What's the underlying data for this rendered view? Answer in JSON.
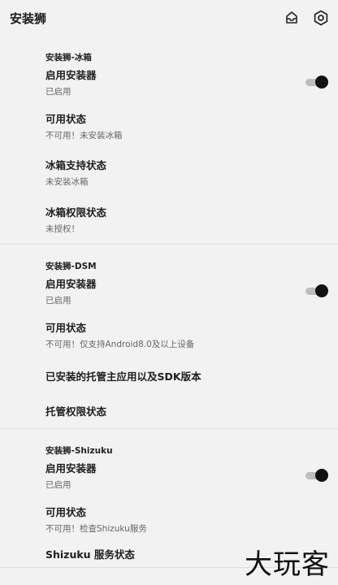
{
  "appbar": {
    "title": "安装狮"
  },
  "sections": [
    {
      "header": "安装狮-冰箱",
      "enable": {
        "title": "启用安装器",
        "subtitle": "已启用"
      },
      "status": {
        "title": "可用状态",
        "subtitle": "不可用！未安装冰箱"
      },
      "support": {
        "title": "冰箱支持状态",
        "subtitle": "未安装冰箱"
      },
      "permission": {
        "title": "冰箱权限状态",
        "subtitle": "未授权！"
      }
    },
    {
      "header": "安装狮-DSM",
      "enable": {
        "title": "启用安装器",
        "subtitle": "已启用"
      },
      "status": {
        "title": "可用状态",
        "subtitle": "不可用！仅支持Android8.0及以上设备"
      },
      "sdk": {
        "title": "已安装的托管主应用以及SDK版本"
      },
      "permission": {
        "title": "托管权限状态"
      }
    },
    {
      "header": "安装狮-Shizuku",
      "enable": {
        "title": "启用安装器",
        "subtitle": "已启用"
      },
      "status": {
        "title": "可用状态",
        "subtitle": "不可用！检查Shizuku服务"
      },
      "service": {
        "title": "Shizuku 服务状态"
      }
    }
  ],
  "watermark": "大玩客"
}
